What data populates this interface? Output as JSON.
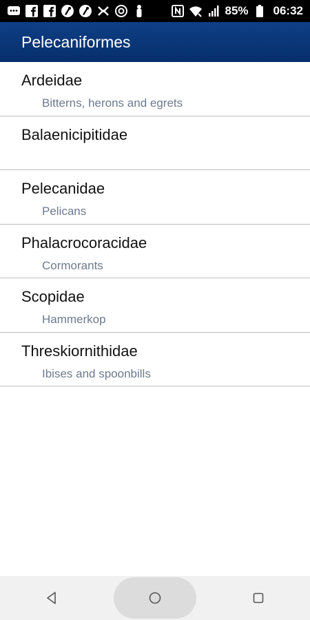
{
  "status_bar": {
    "icons_left": [
      "messages-icon",
      "facebook-icon",
      "facebook-icon",
      "tune-icon",
      "tune-icon",
      "fan-icon",
      "at-sign-icon",
      "figure-icon"
    ],
    "icons_right": [
      "nfc-icon",
      "wifi-icon",
      "signal-icon"
    ],
    "battery": "85%",
    "time": "06:32"
  },
  "app_bar": {
    "title": "Pelecaniformes",
    "color": "#0a367a"
  },
  "families": [
    {
      "name": "Ardeidae",
      "common": "Bitterns, herons and egrets"
    },
    {
      "name": "Balaenicipitidae",
      "common": ""
    },
    {
      "name": "Pelecanidae",
      "common": "Pelicans"
    },
    {
      "name": "Phalacrocoracidae",
      "common": "Cormorants"
    },
    {
      "name": "Scopidae",
      "common": "Hammerkop"
    },
    {
      "name": "Threskiornithidae",
      "common": "Ibises and spoonbills"
    }
  ],
  "nav_bar": {
    "buttons": [
      "back-icon",
      "home-icon",
      "recents-icon"
    ]
  }
}
